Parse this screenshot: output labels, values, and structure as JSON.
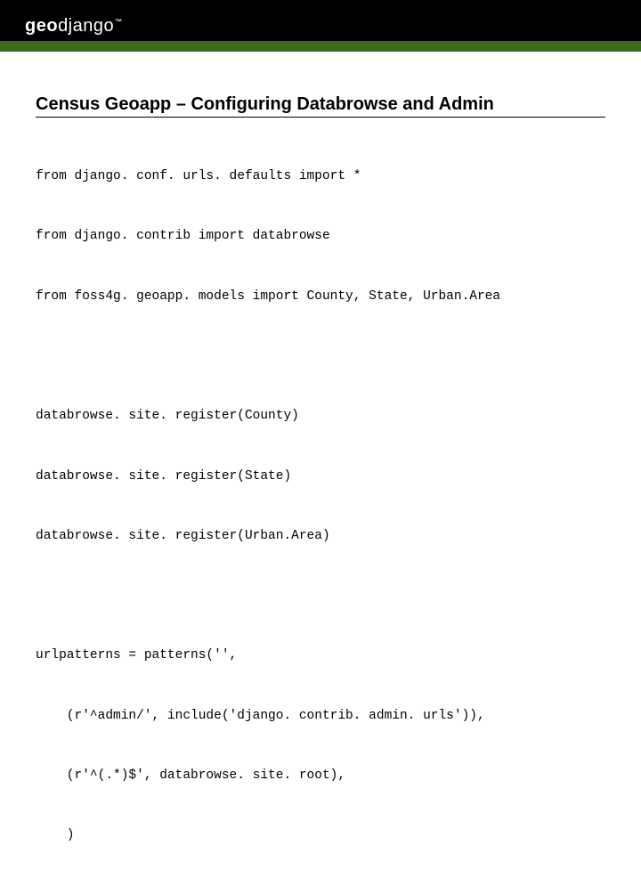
{
  "brand": {
    "geo": "geo",
    "django": "django",
    "tm": "™"
  },
  "title": "Census Geoapp – Configuring Databrowse and Admin",
  "code": {
    "block1": [
      "from django. conf. urls. defaults import *",
      "from django. contrib import databrowse",
      "from foss4g. geoapp. models import County, State, Urban.Area"
    ],
    "block2": [
      "databrowse. site. register(County)",
      "databrowse. site. register(State)",
      "databrowse. site. register(Urban.Area)"
    ],
    "block3": [
      "urlpatterns = patterns('',",
      "    (r'^admin/', include('django. contrib. admin. urls')),",
      "    (r'^(.*)$', databrowse. site. root),",
      "    )"
    ]
  }
}
